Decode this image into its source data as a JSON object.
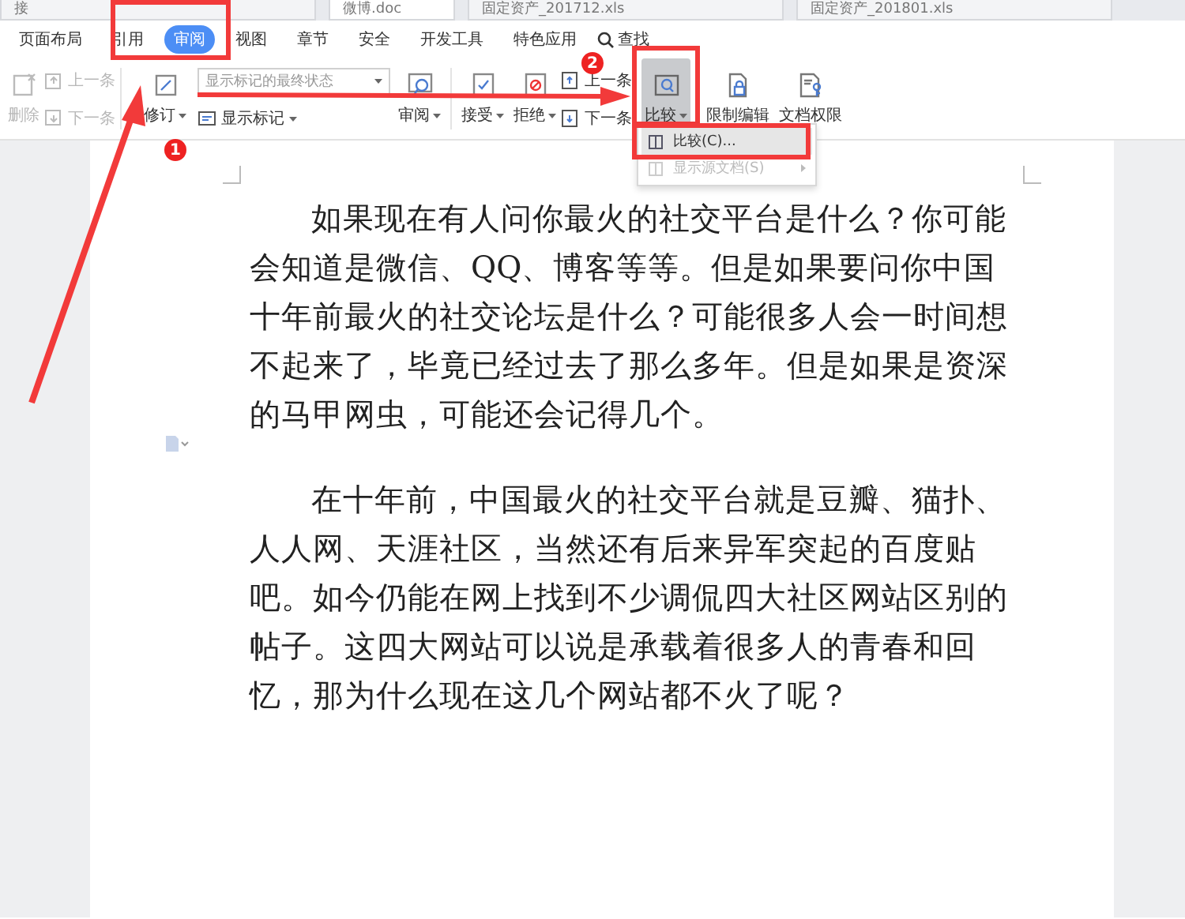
{
  "file_tabs": [
    {
      "label": "接",
      "selected": false
    },
    {
      "label": "微博.doc",
      "selected": true
    },
    {
      "label": "固定资产_201712.xls",
      "selected": false
    },
    {
      "label": "固定资产_201801.xls",
      "selected": false
    }
  ],
  "menu": [
    {
      "label": "页面布局",
      "selected": false
    },
    {
      "label": "引用",
      "selected": false
    },
    {
      "label": "审阅",
      "selected": true
    },
    {
      "label": "视图",
      "selected": false
    },
    {
      "label": "章节",
      "selected": false
    },
    {
      "label": "安全",
      "selected": false
    },
    {
      "label": "开发工具",
      "selected": false
    },
    {
      "label": "特色应用",
      "selected": false
    }
  ],
  "search": {
    "label": "查找"
  },
  "toolbar": {
    "delete": {
      "label": "删除",
      "disabled": true
    },
    "prev": {
      "label": "上一条",
      "disabled": true
    },
    "next": {
      "label": "下一条",
      "disabled": true
    },
    "track": {
      "label": "修订"
    },
    "markup_select": {
      "value": "显示标记的最终状态"
    },
    "show_markup": {
      "label": "显示标记"
    },
    "review": {
      "label": "审阅"
    },
    "accept": {
      "label": "接受"
    },
    "reject": {
      "label": "拒绝"
    },
    "prev2": {
      "label": "上一条"
    },
    "next2": {
      "label": "下一条"
    },
    "compare": {
      "label": "比较",
      "selected": true
    },
    "restrict": {
      "label": "限制编辑"
    },
    "permission": {
      "label": "文档权限"
    }
  },
  "compare_menu": [
    {
      "label": "比较(C)...",
      "selected": true,
      "disabled": false,
      "has_submenu": false
    },
    {
      "label": "显示源文档(S)",
      "selected": false,
      "disabled": true,
      "has_submenu": true
    }
  ],
  "document": {
    "paragraphs": [
      "如果现在有人问你最火的社交平台是什么？你可能会知道是微信、QQ、博客等等。但是如果要问你中国十年前最火的社交论坛是什么？可能很多人会一时间想不起来了，毕竟已经过去了那么多年。但是如果是资深的马甲网虫，可能还会记得几个。",
      "在十年前，中国最火的社交平台就是豆瓣、猫扑、人人网、天涯社区，当然还有后来异军突起的百度贴吧。如今仍能在网上找到不少调侃四大社区网站区别的帖子。这四大网站可以说是承载着很多人的青春和回忆，那为什么现在这几个网站都不火了呢？"
    ]
  },
  "annotations": {
    "badges": [
      "1",
      "2"
    ]
  }
}
